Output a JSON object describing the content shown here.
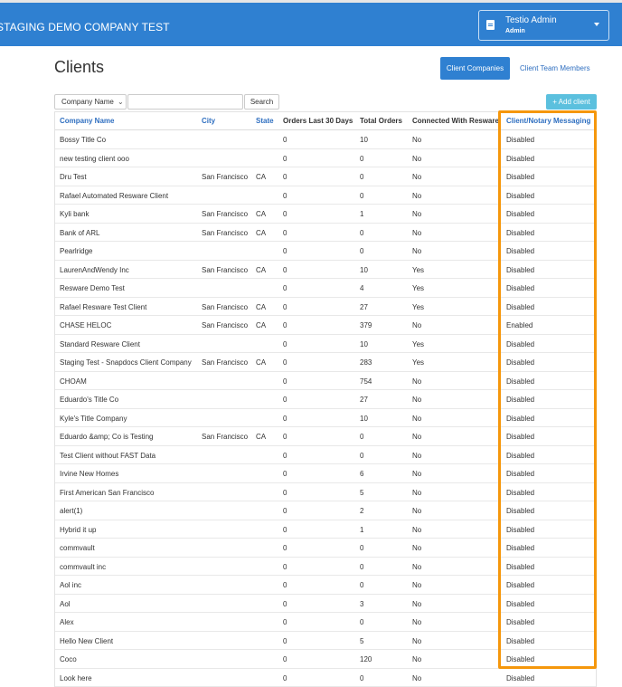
{
  "header": {
    "app_title": "STAGING DEMO COMPANY TEST",
    "user_name": "Testio Admin",
    "user_role": "Admin",
    "user_icon": "id-card-icon",
    "caret_icon": "chevron-down-icon"
  },
  "page": {
    "title": "Clients",
    "btn_companies": "Client Companies",
    "link_team": "Client Team Members"
  },
  "toolbar": {
    "filter_select": "Company Name",
    "search_value": "",
    "search_label": "Search",
    "add_label": "+ Add client"
  },
  "table": {
    "headers": {
      "company": "Company Name",
      "city": "City",
      "state": "State",
      "orders30": "Orders Last 30 Days",
      "total": "Total Orders",
      "resware": "Connected With Resware",
      "messaging": "Client/Notary Messaging"
    },
    "rows": [
      {
        "company": "Bossy Title Co",
        "city": "",
        "state": "",
        "orders30": "0",
        "total": "10",
        "resware": "No",
        "messaging": "Disabled"
      },
      {
        "company": "new testing client ooo",
        "city": "",
        "state": "",
        "orders30": "0",
        "total": "0",
        "resware": "No",
        "messaging": "Disabled"
      },
      {
        "company": "Dru Test",
        "city": "San Francisco",
        "state": "CA",
        "orders30": "0",
        "total": "0",
        "resware": "No",
        "messaging": "Disabled"
      },
      {
        "company": "Rafael Automated Resware Client",
        "city": "",
        "state": "",
        "orders30": "0",
        "total": "0",
        "resware": "No",
        "messaging": "Disabled"
      },
      {
        "company": "Kyli bank",
        "city": "San Francisco",
        "state": "CA",
        "orders30": "0",
        "total": "1",
        "resware": "No",
        "messaging": "Disabled"
      },
      {
        "company": "Bank of ARL",
        "city": "San Francisco",
        "state": "CA",
        "orders30": "0",
        "total": "0",
        "resware": "No",
        "messaging": "Disabled"
      },
      {
        "company": "Pearlridge",
        "city": "",
        "state": "",
        "orders30": "0",
        "total": "0",
        "resware": "No",
        "messaging": "Disabled"
      },
      {
        "company": "LaurenAndWendy Inc",
        "city": "San Francisco",
        "state": "CA",
        "orders30": "0",
        "total": "10",
        "resware": "Yes",
        "messaging": "Disabled"
      },
      {
        "company": "Resware Demo Test",
        "city": "",
        "state": "",
        "orders30": "0",
        "total": "4",
        "resware": "Yes",
        "messaging": "Disabled"
      },
      {
        "company": "Rafael Resware Test Client",
        "city": "San Francisco",
        "state": "CA",
        "orders30": "0",
        "total": "27",
        "resware": "Yes",
        "messaging": "Disabled"
      },
      {
        "company": "CHASE HELOC",
        "city": "San Francisco",
        "state": "CA",
        "orders30": "0",
        "total": "379",
        "resware": "No",
        "messaging": "Enabled"
      },
      {
        "company": "Standard Resware Client",
        "city": "",
        "state": "",
        "orders30": "0",
        "total": "10",
        "resware": "Yes",
        "messaging": "Disabled"
      },
      {
        "company": "Staging Test - Snapdocs Client Company",
        "city": "San Francisco",
        "state": "CA",
        "orders30": "0",
        "total": "283",
        "resware": "Yes",
        "messaging": "Disabled"
      },
      {
        "company": "CHOAM",
        "city": "",
        "state": "",
        "orders30": "0",
        "total": "754",
        "resware": "No",
        "messaging": "Disabled"
      },
      {
        "company": "Eduardo's Title Co",
        "city": "",
        "state": "",
        "orders30": "0",
        "total": "27",
        "resware": "No",
        "messaging": "Disabled"
      },
      {
        "company": "Kyle's Title Company",
        "city": "",
        "state": "",
        "orders30": "0",
        "total": "10",
        "resware": "No",
        "messaging": "Disabled"
      },
      {
        "company": "Eduardo &amp; Co is Testing",
        "city": "San Francisco",
        "state": "CA",
        "orders30": "0",
        "total": "0",
        "resware": "No",
        "messaging": "Disabled"
      },
      {
        "company": "Test Client without FAST Data",
        "city": "",
        "state": "",
        "orders30": "0",
        "total": "0",
        "resware": "No",
        "messaging": "Disabled"
      },
      {
        "company": "Irvine New Homes",
        "city": "",
        "state": "",
        "orders30": "0",
        "total": "6",
        "resware": "No",
        "messaging": "Disabled"
      },
      {
        "company": "First American San Francisco",
        "city": "",
        "state": "",
        "orders30": "0",
        "total": "5",
        "resware": "No",
        "messaging": "Disabled"
      },
      {
        "company": "alert(1)",
        "city": "",
        "state": "",
        "orders30": "0",
        "total": "2",
        "resware": "No",
        "messaging": "Disabled"
      },
      {
        "company": "Hybrid it up",
        "city": "",
        "state": "",
        "orders30": "0",
        "total": "1",
        "resware": "No",
        "messaging": "Disabled"
      },
      {
        "company": "commvault",
        "city": "",
        "state": "",
        "orders30": "0",
        "total": "0",
        "resware": "No",
        "messaging": "Disabled"
      },
      {
        "company": "commvault inc",
        "city": "",
        "state": "",
        "orders30": "0",
        "total": "0",
        "resware": "No",
        "messaging": "Disabled"
      },
      {
        "company": "Aol inc",
        "city": "",
        "state": "",
        "orders30": "0",
        "total": "0",
        "resware": "No",
        "messaging": "Disabled"
      },
      {
        "company": "Aol",
        "city": "",
        "state": "",
        "orders30": "0",
        "total": "3",
        "resware": "No",
        "messaging": "Disabled"
      },
      {
        "company": "Alex",
        "city": "",
        "state": "",
        "orders30": "0",
        "total": "0",
        "resware": "No",
        "messaging": "Disabled"
      },
      {
        "company": "Hello New Client",
        "city": "",
        "state": "",
        "orders30": "0",
        "total": "5",
        "resware": "No",
        "messaging": "Disabled"
      },
      {
        "company": "Coco",
        "city": "",
        "state": "",
        "orders30": "0",
        "total": "120",
        "resware": "No",
        "messaging": "Disabled"
      },
      {
        "company": "Look here",
        "city": "",
        "state": "",
        "orders30": "0",
        "total": "0",
        "resware": "No",
        "messaging": "Disabled"
      }
    ]
  },
  "colors": {
    "brand_blue": "#2f80d1",
    "link_blue": "#2f6fc0",
    "add_button": "#5bc0de",
    "highlight_orange": "#f5970c"
  }
}
